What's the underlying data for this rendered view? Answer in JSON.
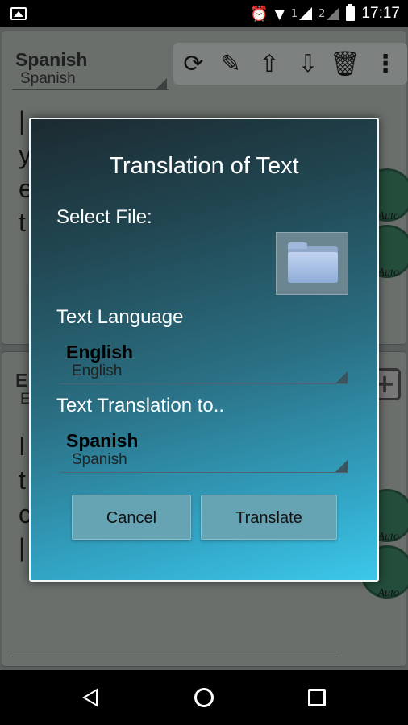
{
  "status_bar": {
    "sim1": "1",
    "sim2": "2",
    "time": "17:17"
  },
  "background_app": {
    "top_panel": {
      "language_title": "Spanish",
      "language_sub": "Spanish",
      "text_lines": [
        "|",
        "y",
        "e",
        "t"
      ]
    },
    "bottom_panel": {
      "language_title": "En",
      "language_sub": "E",
      "text_lines": [
        "I",
        "t",
        "c",
        "|"
      ]
    },
    "auto_label": "Auto",
    "toolbar_icons": [
      "refresh-icon",
      "translate-icon",
      "upload-icon",
      "download-icon",
      "trash-icon",
      "more-icon"
    ]
  },
  "dialog": {
    "title": "Translation of Text",
    "select_file_label": "Select File:",
    "text_language_label": "Text Language",
    "source_language": {
      "title": "English",
      "sub": "English"
    },
    "translation_to_label": "Text Translation to..",
    "target_language": {
      "title": "Spanish",
      "sub": "Spanish"
    },
    "cancel_label": "Cancel",
    "translate_label": "Translate"
  },
  "colors": {
    "dialog_gradient_start": "#1c2a30",
    "dialog_gradient_end": "#3cc8ea",
    "button_bg": "#66a3b3"
  }
}
